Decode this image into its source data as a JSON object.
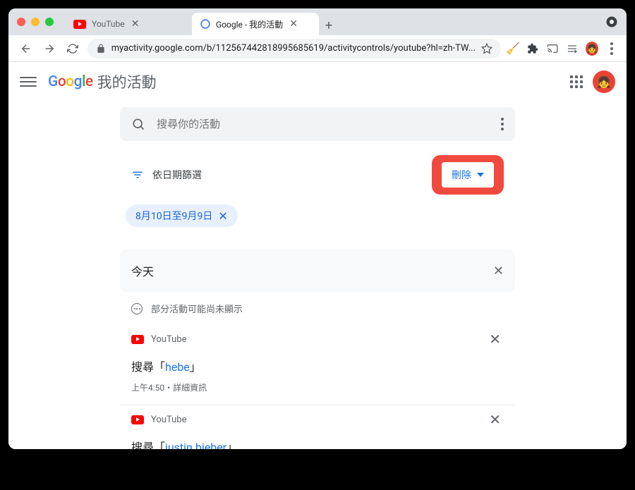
{
  "browser": {
    "tabs": [
      {
        "title": "YouTube",
        "active": false
      },
      {
        "title": "Google - 我的活動",
        "active": true
      }
    ],
    "url": "myactivity.google.com/b/112567442818995685619/activitycontrols/youtube?hl=zh-TW..."
  },
  "header": {
    "logo_text": {
      "g1": "G",
      "o1": "o",
      "o2": "o",
      "g2": "g",
      "l": "l",
      "e": "e"
    },
    "app_title": "我的活動"
  },
  "search": {
    "placeholder": "搜尋你的活動"
  },
  "filter": {
    "label": "依日期篩選",
    "delete_label": "刪除",
    "chip_label": "8月10日至9月9日"
  },
  "section_today": "今天",
  "notice_text": "部分活動可能尚未顯示",
  "items": [
    {
      "source": "YouTube",
      "action_prefix": "搜尋「",
      "query": "hebe",
      "action_suffix": "」",
      "time": "上午4:50",
      "meta_sep": "・",
      "details": "詳細資訊"
    },
    {
      "source": "YouTube",
      "action_prefix": "搜尋「",
      "query": "justin bieber",
      "action_suffix": "」",
      "time": "",
      "meta_sep": "",
      "details": ""
    }
  ]
}
